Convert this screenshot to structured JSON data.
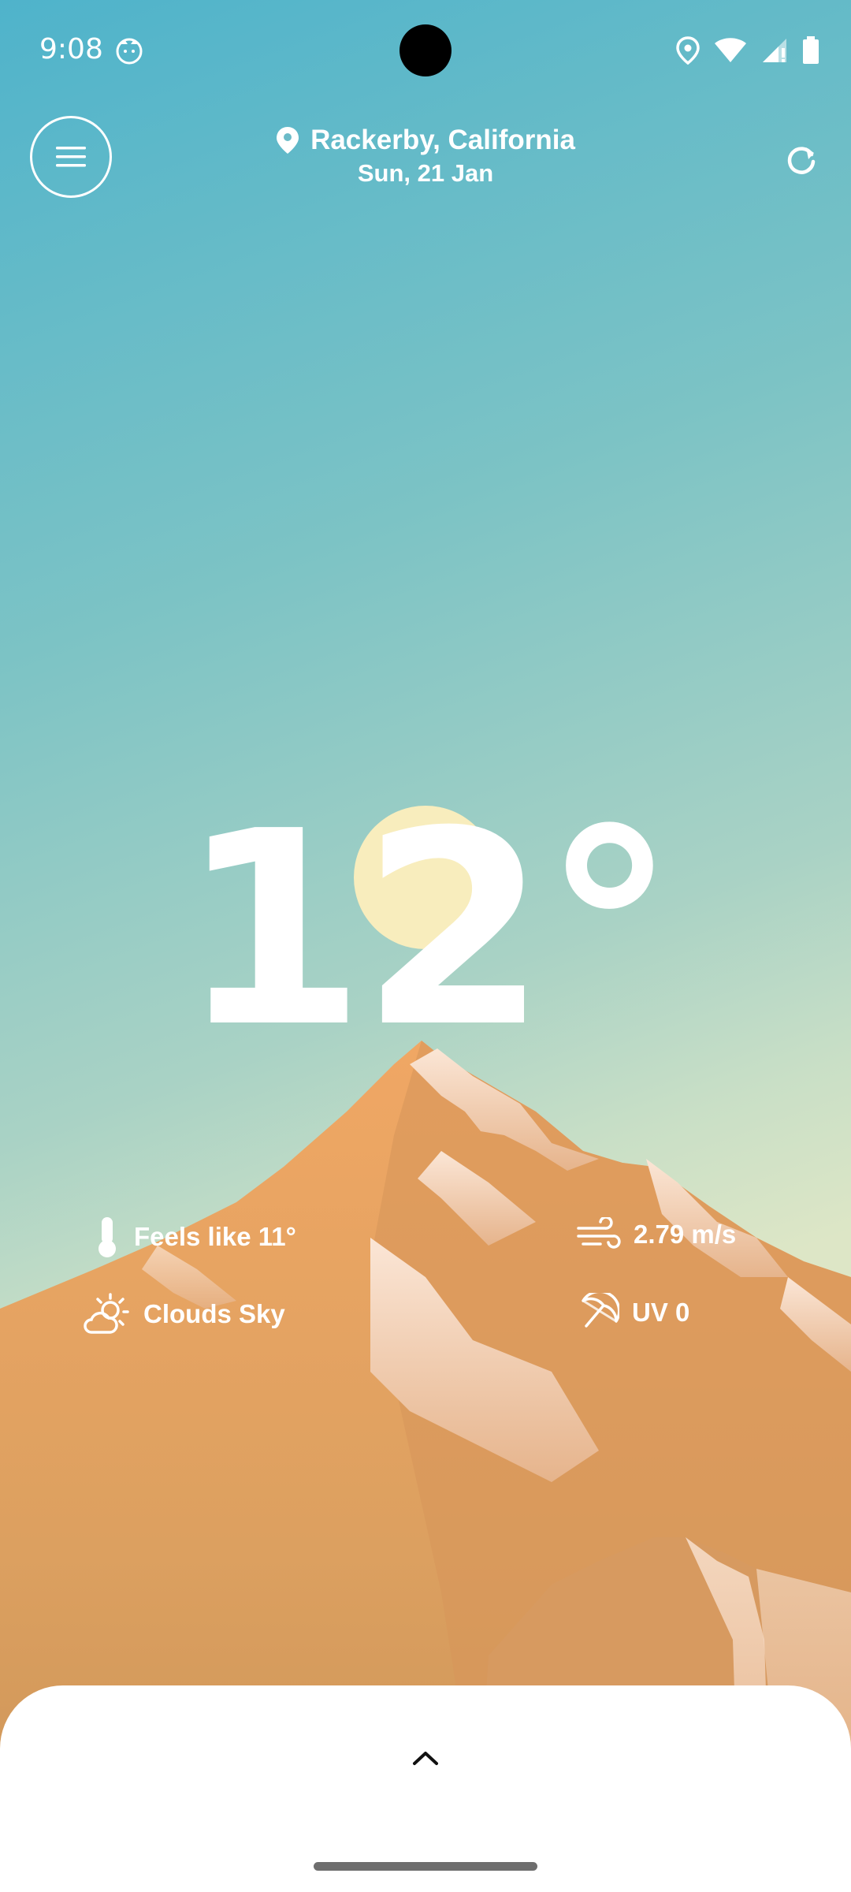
{
  "status_bar": {
    "time": "9:08",
    "icons": [
      "cat-app-icon",
      "location-icon",
      "wifi-icon",
      "signal-icon",
      "battery-icon"
    ]
  },
  "header": {
    "location": "Rackerby, California",
    "date": "Sun, 21 Jan",
    "icons": [
      "menu-icon",
      "location-pin-icon",
      "refresh-icon"
    ]
  },
  "weather": {
    "temperature": "12°",
    "feels_like": "Feels like 11°",
    "wind": "2.79 m/s",
    "condition": "Clouds Sky",
    "uv": "UV 0"
  },
  "colors": {
    "sky_top": "#4fb3cb",
    "sky_bottom": "#dde6c6",
    "mountain": "#e3a060",
    "snow": "#f6dcc6",
    "sun": "#fdeebd",
    "sheet": "#ffffff"
  }
}
